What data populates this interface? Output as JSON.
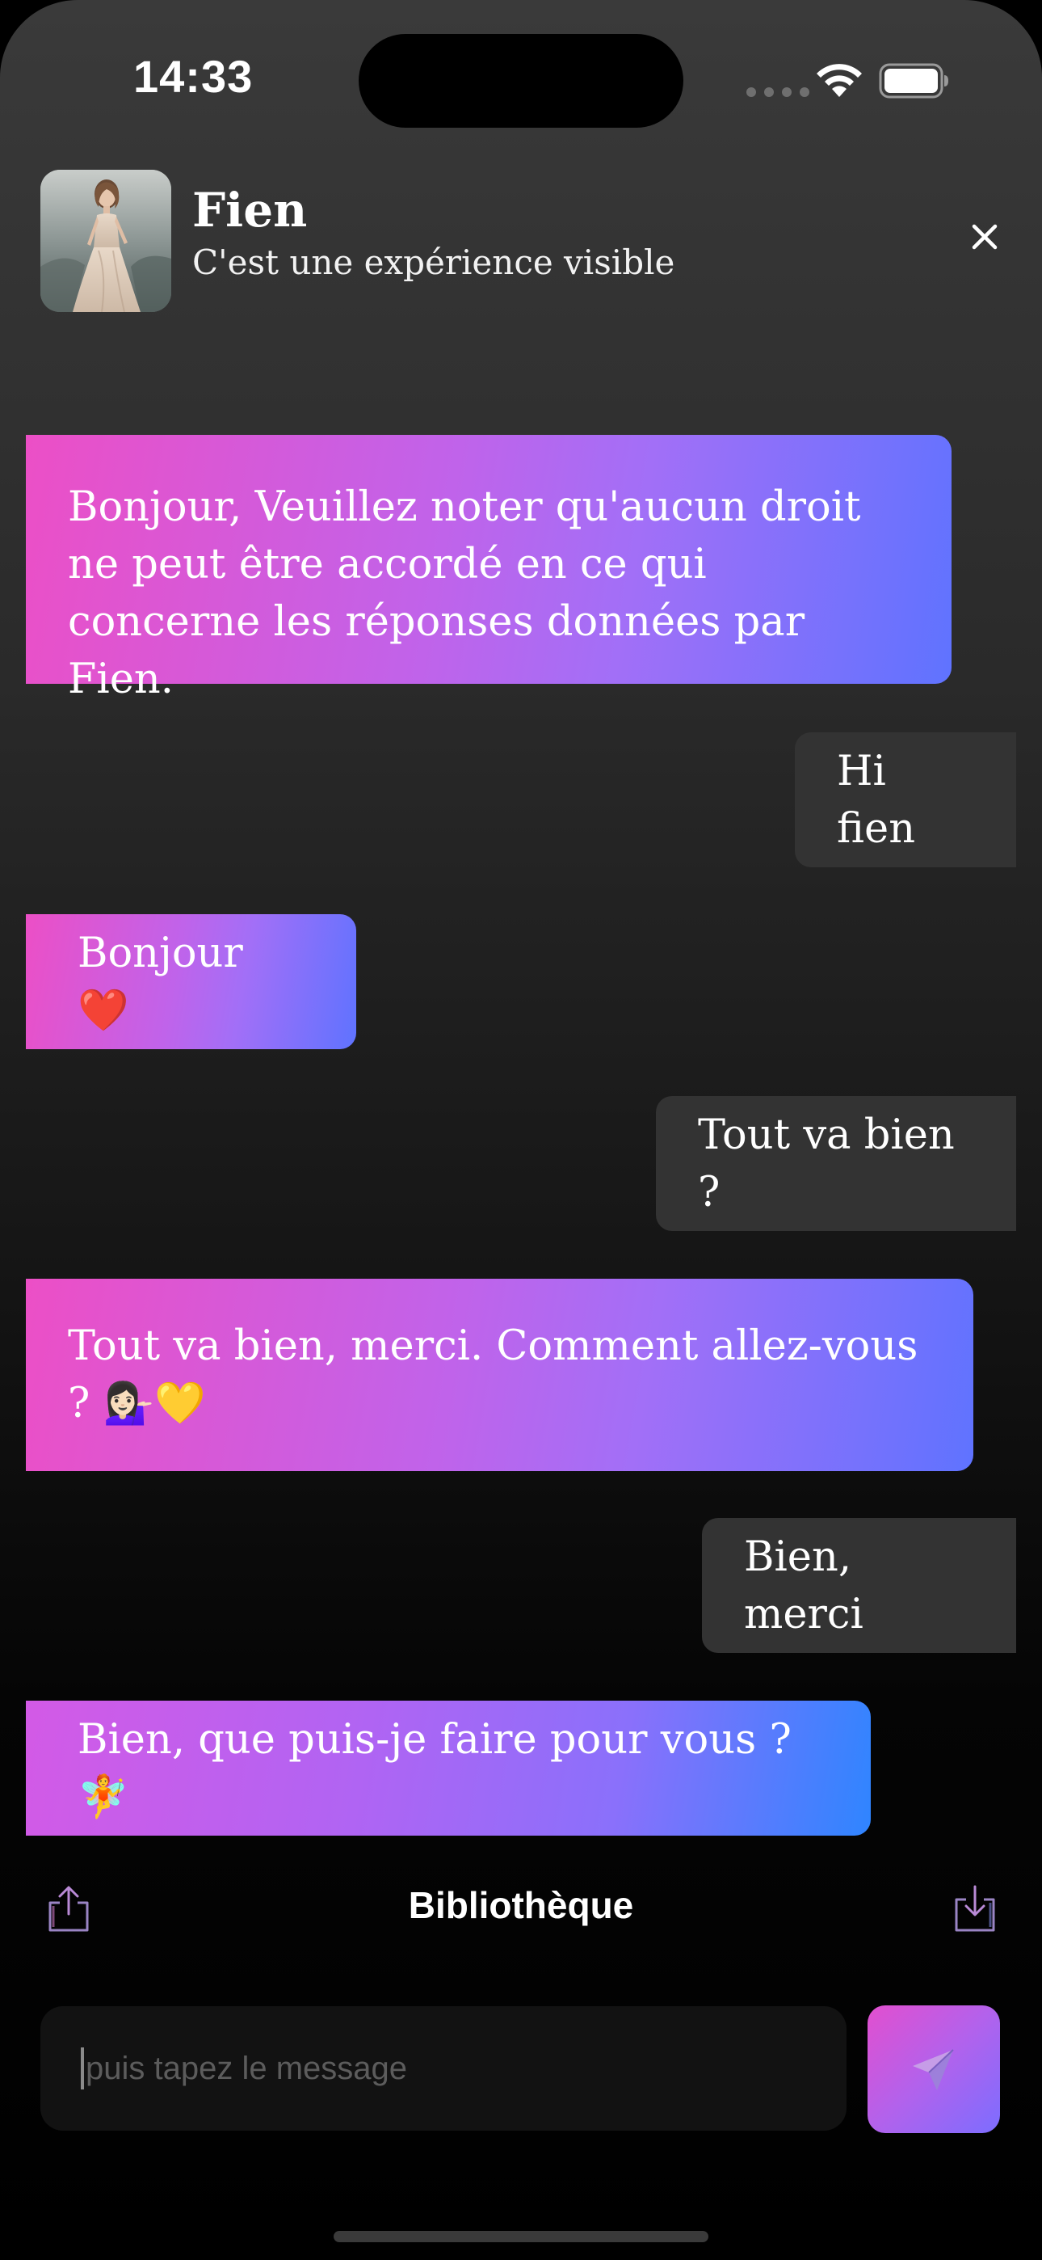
{
  "status_bar": {
    "time": "14:33"
  },
  "header": {
    "name": "Fien",
    "subtitle": "C'est une expérience visible"
  },
  "messages": [
    {
      "role": "bot",
      "text": "Bonjour, Veuillez noter qu'aucun droit ne peut être accordé en ce qui concerne les réponses données par Fien."
    },
    {
      "role": "user",
      "text": "Hi fien"
    },
    {
      "role": "bot",
      "text": "Bonjour ❤️"
    },
    {
      "role": "user",
      "text": "Tout va bien ?"
    },
    {
      "role": "bot",
      "text": "Tout va bien, merci. Comment allez-vous ? 💁🏻‍♀️💛"
    },
    {
      "role": "user",
      "text": "Bien, merci"
    },
    {
      "role": "bot",
      "text": "Bien, que puis-je faire pour vous ? 🧚"
    }
  ],
  "toolbar": {
    "title": "Bibliothèque"
  },
  "composer": {
    "placeholder": "puis tapez le message"
  },
  "colors": {
    "bot_bubble_start": "#ec4fc6",
    "bot_bubble_end": "#5f73ff",
    "user_bubble": "#333333"
  }
}
